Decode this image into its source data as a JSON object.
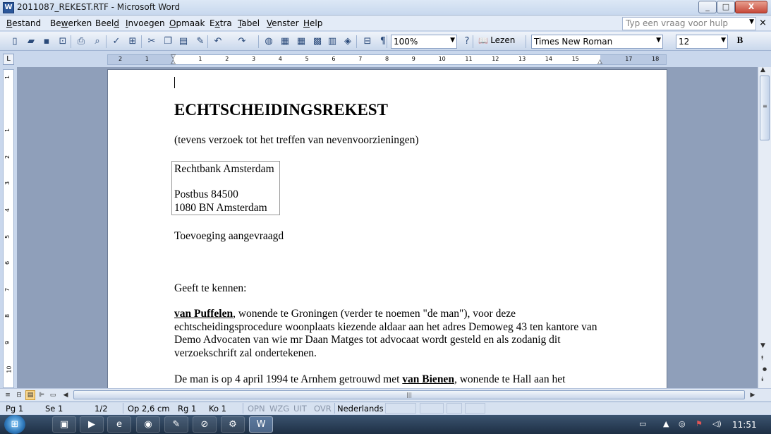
{
  "window": {
    "title": "2011087_REKEST.RTF - Microsoft Word",
    "app_icon": "W",
    "minimize": "_",
    "maximize": "□",
    "close": "X"
  },
  "menu": {
    "items": [
      {
        "pre": "",
        "key": "B",
        "post": "estand"
      },
      {
        "pre": "Be",
        "key": "w",
        "post": "erken"
      },
      {
        "pre": "Beel",
        "key": "d",
        "post": ""
      },
      {
        "pre": "",
        "key": "I",
        "post": "nvoegen"
      },
      {
        "pre": "",
        "key": "O",
        "post": "pmaak"
      },
      {
        "pre": "E",
        "key": "x",
        "post": "tra"
      },
      {
        "pre": "",
        "key": "T",
        "post": "abel"
      },
      {
        "pre": "",
        "key": "V",
        "post": "enster"
      },
      {
        "pre": "",
        "key": "H",
        "post": "elp"
      }
    ],
    "help_placeholder": "Typ een vraag voor hulp",
    "close_doc": "×"
  },
  "toolbar": {
    "zoom": "100%",
    "read_label": "Lezen",
    "font_name": "Times New Roman",
    "font_size": "12",
    "bold_label": "B",
    "icons": [
      "new-doc-icon",
      "open-folder-icon",
      "save-icon",
      "permission-icon",
      "print-icon",
      "print-preview-icon",
      "spelling-icon",
      "research-icon",
      "cut-icon",
      "copy-icon",
      "paste-icon",
      "format-painter-icon",
      "undo-icon",
      "redo-icon",
      "hyperlink-icon",
      "tables-borders-icon",
      "insert-table-icon",
      "insert-excel-icon",
      "columns-icon",
      "drawing-icon",
      "document-map-icon",
      "show-formatting-icon",
      "help-icon"
    ]
  },
  "ruler": {
    "labels": [
      "2",
      "1",
      "",
      "1",
      "2",
      "3",
      "4",
      "5",
      "6",
      "7",
      "8",
      "9",
      "10",
      "11",
      "12",
      "13",
      "14",
      "15",
      "",
      "17",
      "18"
    ]
  },
  "vruler": {
    "labels": [
      "1",
      "",
      "1",
      "2",
      "3",
      "4",
      "5",
      "6",
      "7",
      "8",
      "9",
      "10",
      "11"
    ]
  },
  "document": {
    "heading": "ECHTSCHEIDINGSREKEST",
    "subheading": "(tevens verzoek tot het treffen van nevenvoorzieningen)",
    "address": {
      "line1": "Rechtbank Amsterdam",
      "line2": "Postbus 84500",
      "line3": "1080 BN Amsterdam"
    },
    "toevoeging": "Toevoeging aangevraagd",
    "geeft": "Geeft  te kennen:",
    "para1": {
      "name": " van Puffelen",
      "text": ", wonende te Groningen (verder te noemen \"de man\"), voor deze echtscheidingsprocedure woonplaats kiezende aldaar aan het adres Demoweg 43 ten kantore van Demo Advocaten van wie mr Daan Matges tot advocaat wordt gesteld en als zodanig dit verzoekschrift zal ondertekenen."
    },
    "para2": {
      "pre": "De man is op 4 april 1994 te Arnhem  getrouwd met ",
      "name": " van Bienen",
      "post": ", wonende te Hall aan het"
    }
  },
  "scrollbar": {
    "up": "▲",
    "down": "▼",
    "prev_page": "⯭",
    "browse": "●",
    "next_page": "⯯",
    "grip": "≡"
  },
  "hscroll": {
    "grip": "|||",
    "left": "◀",
    "right": "▶",
    "view_normal": "≡",
    "view_web": "⊟",
    "view_print": "▤",
    "view_outline": "⊫",
    "view_read": "▭"
  },
  "status": {
    "page": "Pg 1",
    "section": "Se 1",
    "pages": "1/2",
    "position": "Op 2,6 cm",
    "line": "Rg 1",
    "column": "Ko 1",
    "rec": "OPN",
    "trk": "WZG",
    "ext": "UIT",
    "ovr": "OVR",
    "language": "Nederlands"
  },
  "taskbar": {
    "start": "⊞",
    "tasks": [
      {
        "name": "explorer-task",
        "glyph": "▣"
      },
      {
        "name": "media-player-task",
        "glyph": "▶"
      },
      {
        "name": "ie-task",
        "glyph": "e"
      },
      {
        "name": "firefox-task",
        "glyph": "◉"
      },
      {
        "name": "folder-task",
        "glyph": "✎"
      },
      {
        "name": "app-task",
        "glyph": "⊘"
      },
      {
        "name": "tools-task",
        "glyph": "⚙"
      },
      {
        "name": "word-task",
        "glyph": "W"
      }
    ],
    "clock": "11:51",
    "tray": [
      "▭",
      "▲",
      "◎",
      "⚑",
      "◁)"
    ]
  }
}
